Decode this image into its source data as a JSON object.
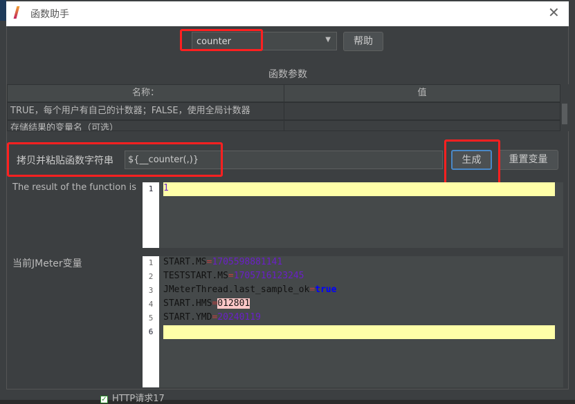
{
  "dialog": {
    "title": "函数助手",
    "close_icon": "close-icon"
  },
  "function_select": {
    "value": "counter"
  },
  "help_button": "帮助",
  "params_section": {
    "title": "函数参数",
    "columns": [
      "名称：",
      "值"
    ],
    "rows": [
      {
        "name": "TRUE，每个用户有自己的计数器；FALSE，使用全局计数器",
        "value": ""
      },
      {
        "name": "存储结果的变量名（可选）",
        "value": ""
      }
    ]
  },
  "copy_paste": {
    "label": "拷贝并粘贴函数字符串",
    "value": "${__counter(,)}"
  },
  "generate_button": "生成",
  "reset_button": "重置变量",
  "result": {
    "label": "The result of the function is",
    "lines": [
      "1"
    ]
  },
  "variables": {
    "label": "当前JMeter变量",
    "lines": [
      {
        "key": "START.MS",
        "value": "1705598881141"
      },
      {
        "key": "TESTSTART.MS",
        "value": "1705716123245"
      },
      {
        "key": "JMeterThread.last_sample_ok",
        "value": "true"
      },
      {
        "key": "START.HMS",
        "value": "012801"
      },
      {
        "key": "START.YMD",
        "value": "20240119"
      }
    ],
    "line_numbers": [
      "1",
      "2",
      "3",
      "4",
      "5",
      "6"
    ]
  },
  "background": {
    "tree_item": "HTTP请求17"
  },
  "colors": {
    "highlight_box": "#ff2020",
    "current_line": "#ffffa8",
    "number": "#6a1fc8",
    "keyword": "#0000ff"
  }
}
